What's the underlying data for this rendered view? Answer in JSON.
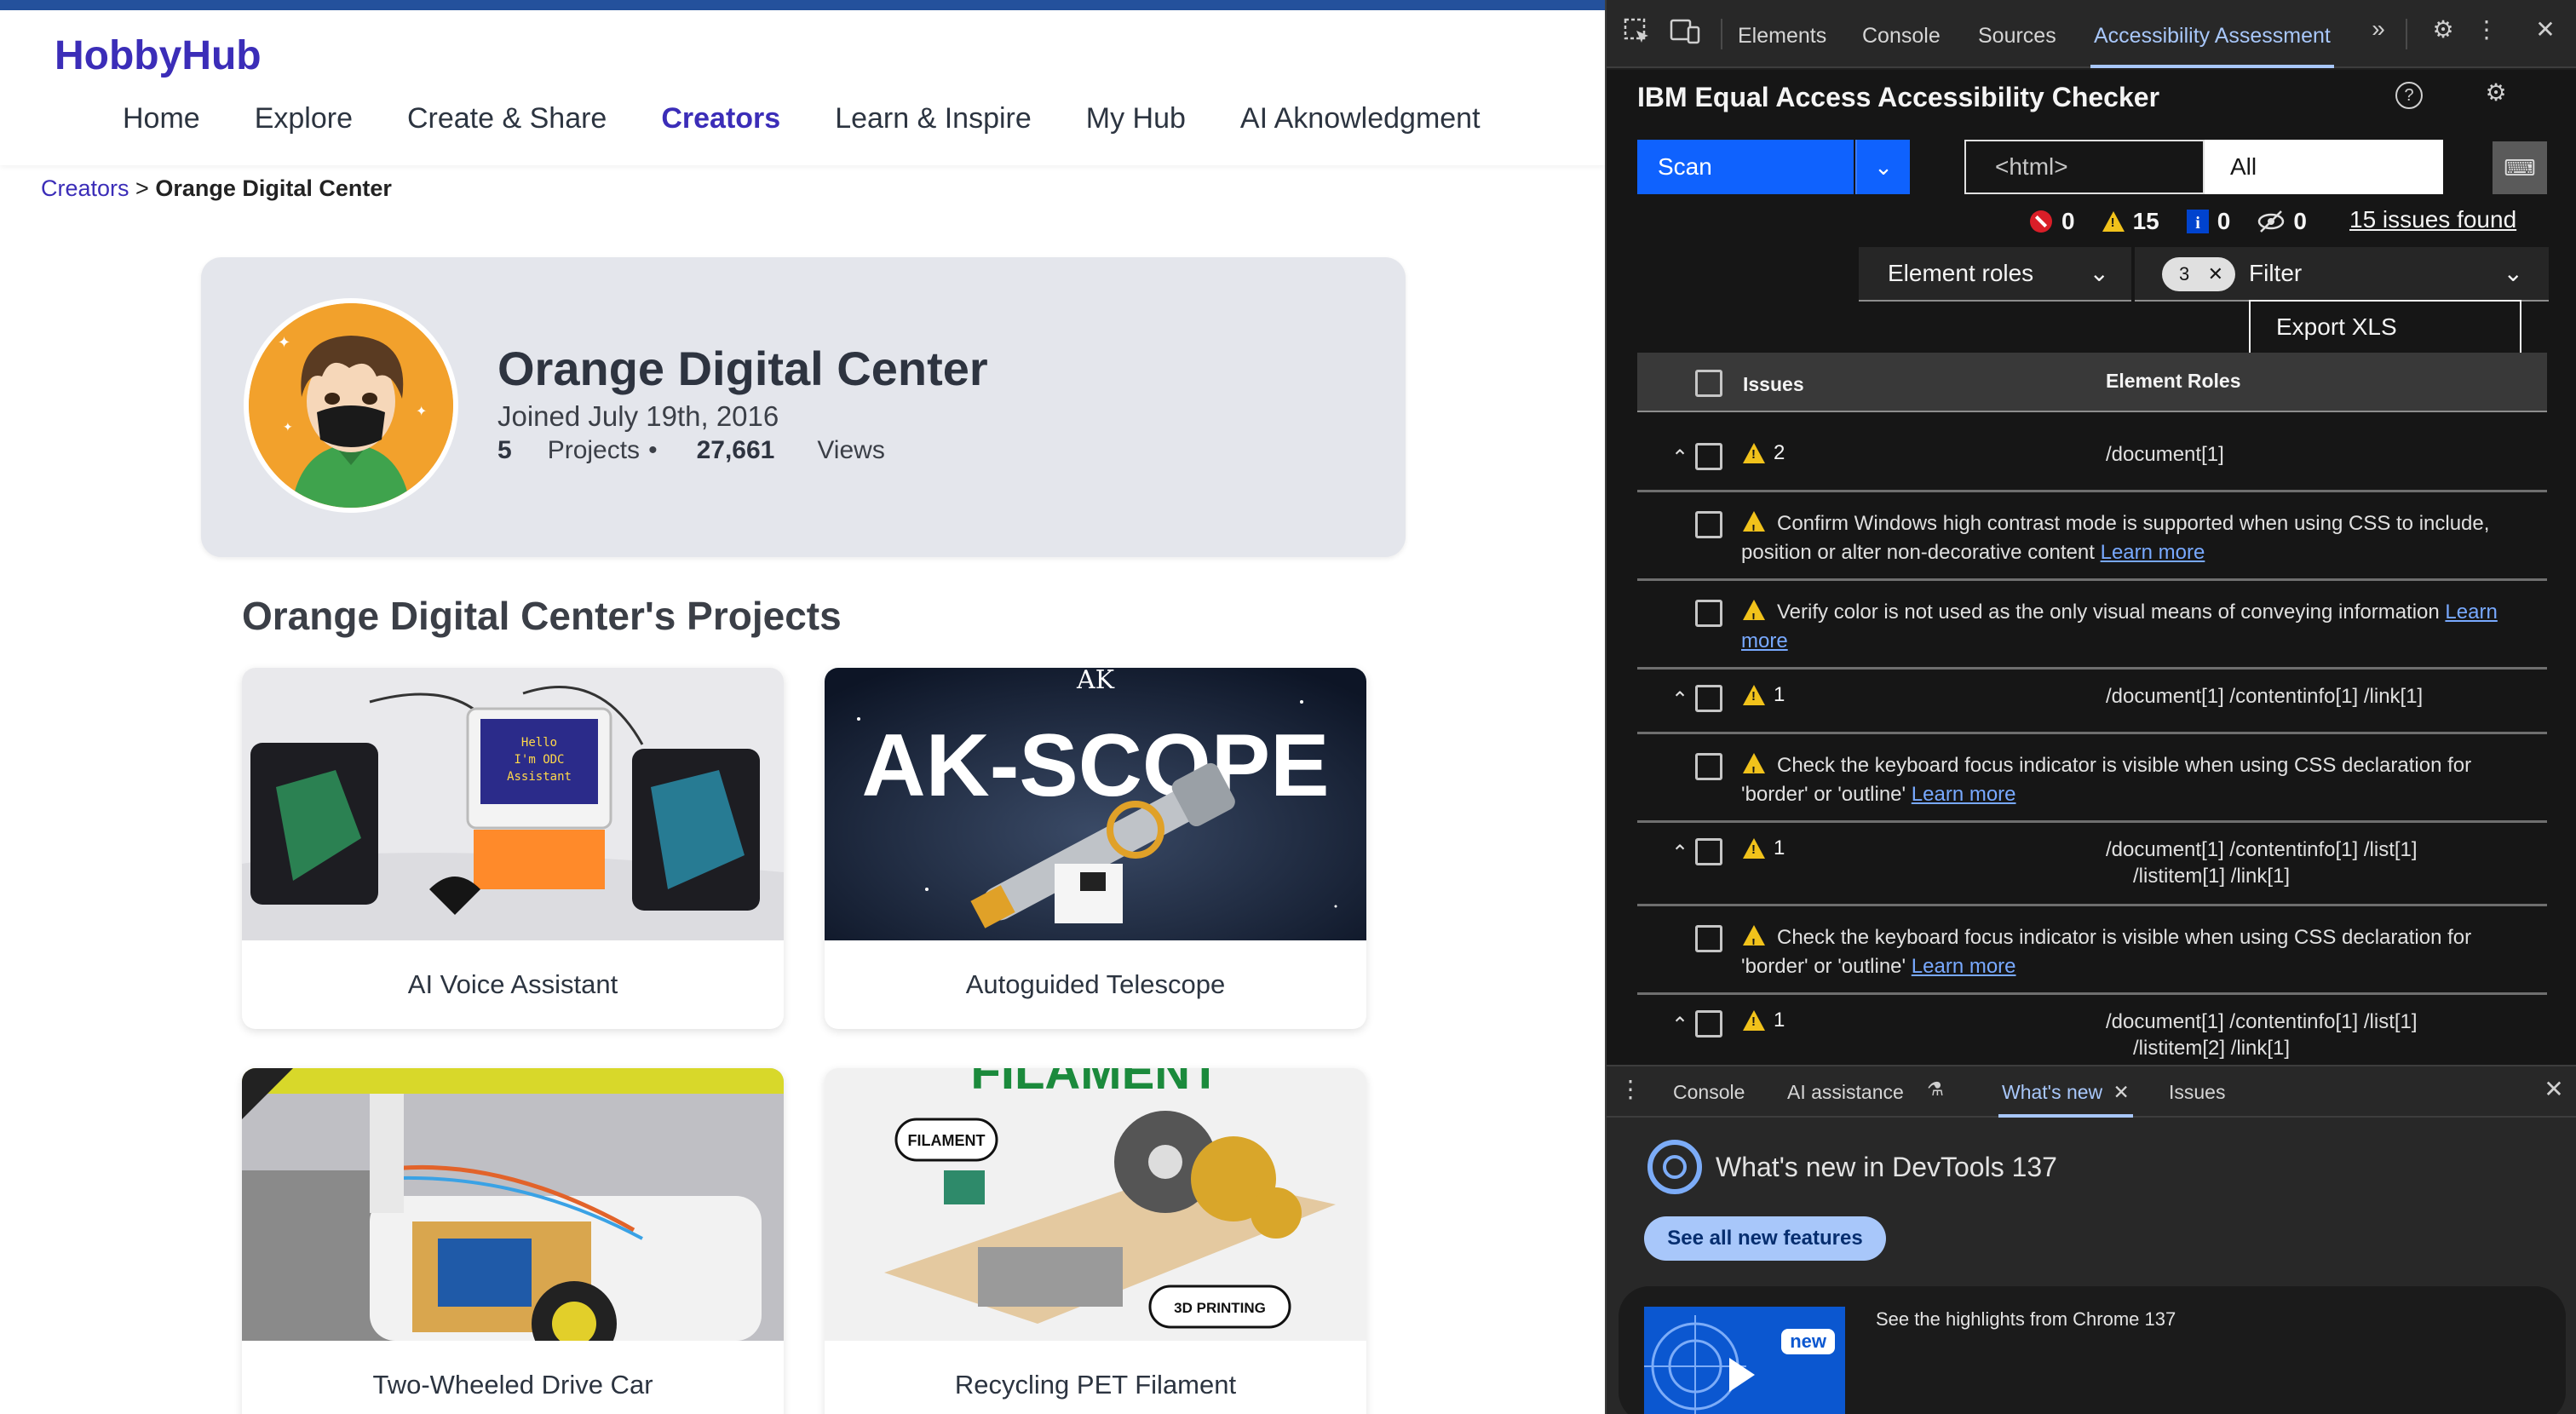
{
  "site": {
    "logo": "HobbyHub",
    "nav": [
      "Home",
      "Explore",
      "Create & Share",
      "Creators",
      "Learn & Inspire",
      "My Hub",
      "AI Aknowledgment"
    ],
    "active_nav": "Creators",
    "breadcrumb": {
      "link": "Creators",
      "separator": ">",
      "current": "Orange Digital Center"
    }
  },
  "profile": {
    "name": "Orange Digital Center",
    "joined": "Joined July 19th, 2016",
    "projects_count": "5",
    "projects_label": "Projects",
    "bullet": "•",
    "views_count": "27,661",
    "views_label": "Views"
  },
  "projects": {
    "title": "Orange Digital Center's Projects",
    "items": [
      {
        "title": "AI Voice Assistant",
        "screen_text": "Hello I'm ODC Assistant"
      },
      {
        "title": "Autoguided Telescope",
        "banner": "AK-SCOPE",
        "badge": "AK"
      },
      {
        "title": "Two-Wheeled Drive Car"
      },
      {
        "title": "Recycling PET Filament",
        "banner": "FILAMENT",
        "tag1": "FILAMENT",
        "tag2": "3D PRINTING"
      }
    ]
  },
  "devtools": {
    "tabs": [
      "Elements",
      "Console",
      "Sources",
      "Accessibility Assessment"
    ],
    "active_tab": "Accessibility Assessment",
    "icons": [
      "inspect-icon",
      "device-toolbar-icon",
      "more-tabs-icon",
      "settings-icon",
      "kebab-menu-icon",
      "close-icon"
    ],
    "checker": {
      "title": "IBM Equal Access Accessibility Checker",
      "scan_label": "Scan",
      "scope_placeholder": "<html>",
      "scope_value": "All",
      "counts": {
        "violations": "0",
        "needs_review": "15",
        "recommendations": "0",
        "hidden": "0"
      },
      "issues_found": "15 issues found",
      "view_select": "Element roles",
      "filter_count": "3",
      "filter_placeholder": "Filter",
      "export_label": "Export XLS",
      "columns": {
        "issues": "Issues",
        "roles": "Element Roles"
      },
      "rows": [
        {
          "kind": "group",
          "count": "2",
          "path": "/document[1]",
          "path2": ""
        },
        {
          "kind": "child",
          "message": "Confirm Windows high contrast mode is supported when using CSS to include, position or alter non-decorative content",
          "link": "Learn more"
        },
        {
          "kind": "child",
          "message": "Verify color is not used as the only visual means of conveying information",
          "link": "Learn more"
        },
        {
          "kind": "group",
          "count": "1",
          "path": "/document[1] /contentinfo[1] /link[1]",
          "path2": ""
        },
        {
          "kind": "child",
          "message": "Check the keyboard focus indicator is visible when using CSS declaration for 'border' or 'outline'",
          "link": "Learn more"
        },
        {
          "kind": "group",
          "count": "1",
          "path": "/document[1] /contentinfo[1] /list[1]",
          "path2": "/listitem[1] /link[1]"
        },
        {
          "kind": "child",
          "message": "Check the keyboard focus indicator is visible when using CSS declaration for 'border' or 'outline'",
          "link": "Learn more"
        },
        {
          "kind": "group",
          "count": "1",
          "path": "/document[1] /contentinfo[1] /list[1]",
          "path2": "/listitem[2] /link[1]"
        }
      ]
    },
    "drawer": {
      "tabs": [
        "Console",
        "AI assistance",
        "What's new",
        "Issues"
      ],
      "active_tab": "What's new",
      "title": "What's new in DevTools 137",
      "button": "See all new features",
      "badge": "new",
      "highlight": "See the highlights from Chrome 137"
    },
    "colors": {
      "accent": "#a8c7fa",
      "scan_blue": "#0f62fe",
      "warning": "#f1c21b",
      "error": "#da1e28",
      "info": "#0043ce"
    }
  }
}
